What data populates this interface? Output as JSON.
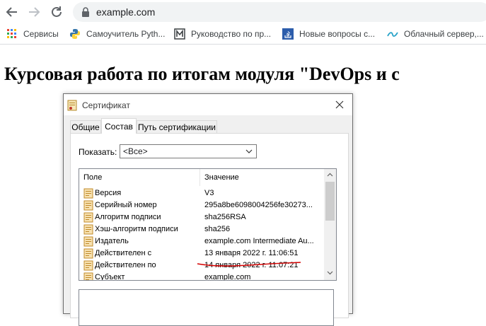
{
  "browser": {
    "url": "example.com",
    "bookmarks": [
      {
        "label": "Сервисы",
        "icon": "apps-grid-icon"
      },
      {
        "label": "Самоучитель Pyth...",
        "icon": "python-icon"
      },
      {
        "label": "Руководство по пр...",
        "icon": "guide-m-icon"
      },
      {
        "label": "Новые вопросы с...",
        "icon": "stackoverflow-icon"
      },
      {
        "label": "Облачный сервер,...",
        "icon": "cloud-wave-icon"
      }
    ]
  },
  "page": {
    "heading": "Курсовая работа по итогам модуля \"DevOps и с"
  },
  "dialog": {
    "title": "Сертификат",
    "tabs": [
      "Общие",
      "Состав",
      "Путь сертификации"
    ],
    "active_tab": "Состав",
    "show_label": "Показать:",
    "show_value": "<Все>",
    "columns": {
      "field": "Поле",
      "value": "Значение"
    },
    "rows": [
      {
        "field": "Версия",
        "value": "V3"
      },
      {
        "field": "Серийный номер",
        "value": "295a8be6098004256fe30273..."
      },
      {
        "field": "Алгоритм подписи",
        "value": "sha256RSA"
      },
      {
        "field": "Хэш-алгоритм подписи",
        "value": "sha256"
      },
      {
        "field": "Издатель",
        "value": "example.com Intermediate Au..."
      },
      {
        "field": "Действителен с",
        "value": "13 января 2022 г. 11:06:51"
      },
      {
        "field": "Действителен по",
        "value": "14 января 2022 г. 11:07:21"
      },
      {
        "field": "Субъект",
        "value": "example.com"
      }
    ],
    "highlight_color": "#d40000"
  }
}
